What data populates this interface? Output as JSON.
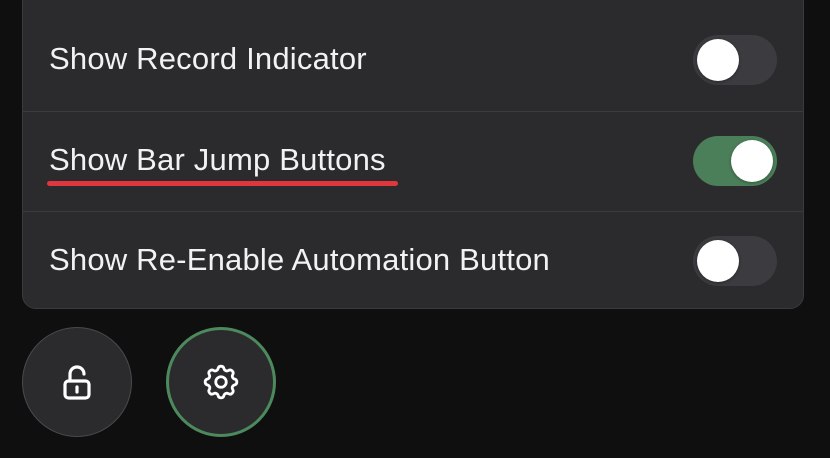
{
  "settings": {
    "rows": [
      {
        "label": "Show Record Indicator",
        "enabled": false
      },
      {
        "label": "Show Bar Jump Buttons",
        "enabled": true,
        "highlighted": true
      },
      {
        "label": "Show Re-Enable Automation Button",
        "enabled": false
      }
    ]
  },
  "footer": {
    "buttons": [
      {
        "icon": "unlock-icon"
      },
      {
        "icon": "gear-icon",
        "active": true
      }
    ]
  },
  "colors": {
    "panel_bg": "#2b2b2e",
    "toggle_on": "#4a7f59",
    "toggle_off": "#3c3c40",
    "highlight_underline": "#e0373f",
    "active_ring": "#4c8a5e"
  }
}
